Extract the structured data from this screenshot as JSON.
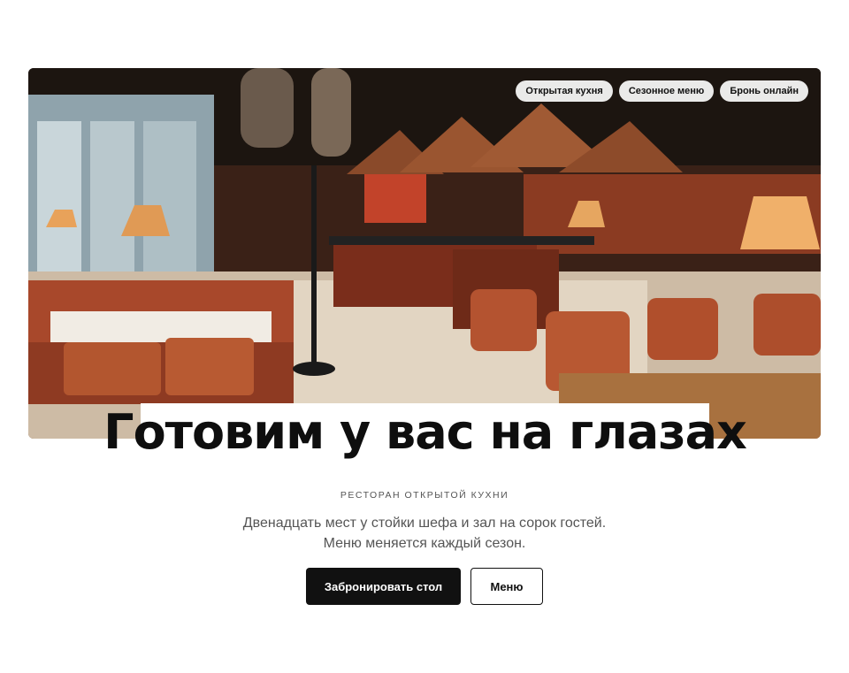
{
  "hero": {
    "chips": [
      "Открытая кухня",
      "Сезонное меню",
      "Бронь онлайн"
    ],
    "image": "restaurant-interior-photo"
  },
  "headline": "Готовим у вас на глазах",
  "eyebrow": "РЕСТОРАН ОТКРЫТОЙ КУХНИ",
  "lede": {
    "line1": "Двенадцать мест у стойки шефа и зал на сорок гостей.",
    "line2": "Меню меняется каждый сезон."
  },
  "actions": {
    "primary": "Забронировать стол",
    "secondary": "Меню"
  },
  "colors": {
    "primary_button": "#111111",
    "chip_bg": "#f5f5f5"
  }
}
